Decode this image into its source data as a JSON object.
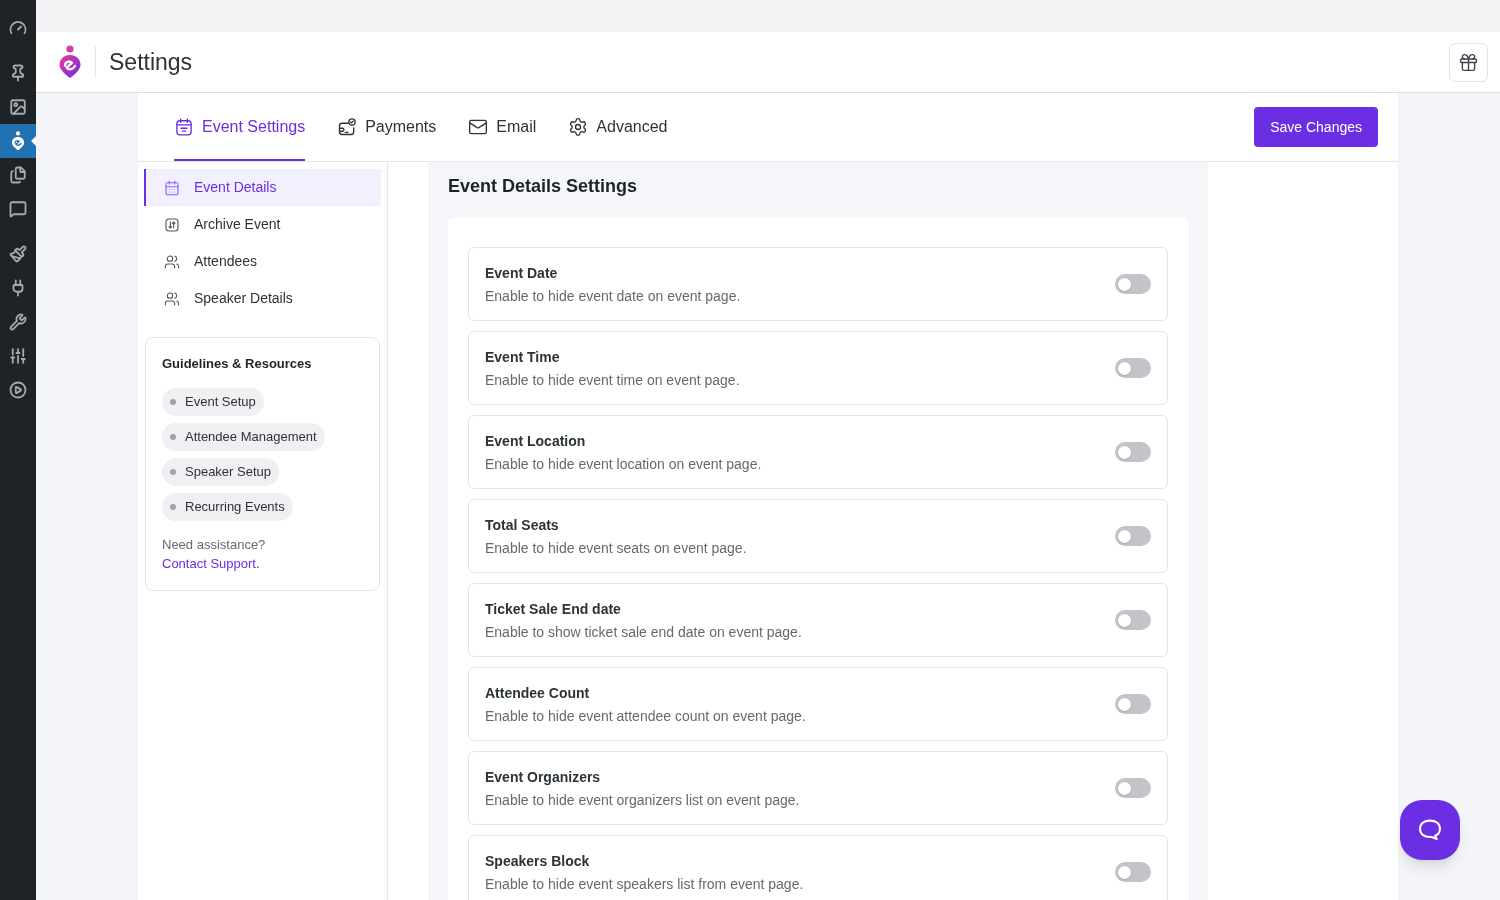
{
  "admin_menu": {
    "items": [
      {
        "selected": false
      },
      {
        "selected": false
      },
      {
        "selected": false
      },
      {
        "selected": true
      },
      {
        "selected": false
      },
      {
        "selected": false
      },
      {
        "selected": false
      },
      {
        "selected": false
      },
      {
        "selected": false
      },
      {
        "selected": false
      },
      {
        "selected": false
      }
    ]
  },
  "header": {
    "title": "Settings"
  },
  "tabs": [
    {
      "label": "Event Settings",
      "selected": true
    },
    {
      "label": "Payments",
      "selected": false
    },
    {
      "label": "Email",
      "selected": false
    },
    {
      "label": "Advanced",
      "selected": false
    }
  ],
  "save_button": "Save Changes",
  "subnav": [
    {
      "label": "Event Details",
      "selected": true
    },
    {
      "label": "Archive Event",
      "selected": false
    },
    {
      "label": "Attendees",
      "selected": false
    },
    {
      "label": "Speaker Details",
      "selected": false
    }
  ],
  "guidelines": {
    "title": "Guidelines & Resources",
    "links": [
      "Event Setup",
      "Attendee Management",
      "Speaker Setup",
      "Recurring Events"
    ],
    "help": {
      "text": "Need assistance?",
      "link": "Contact Support."
    }
  },
  "section": {
    "title": "Event Details Settings",
    "settings": [
      {
        "title": "Event Date",
        "description": "Enable to hide event date on event page.",
        "on": false
      },
      {
        "title": "Event Time",
        "description": "Enable to hide event time on event page.",
        "on": false
      },
      {
        "title": "Event Location",
        "description": "Enable to hide event location on event page.",
        "on": false
      },
      {
        "title": "Total Seats",
        "description": "Enable to hide event seats on event page.",
        "on": false
      },
      {
        "title": "Ticket Sale End date",
        "description": "Enable to show ticket sale end date on event page.",
        "on": false
      },
      {
        "title": "Attendee Count",
        "description": "Enable to hide event attendee count on event page.",
        "on": false
      },
      {
        "title": "Event Organizers",
        "description": "Enable to hide event organizers list on event page.",
        "on": false
      },
      {
        "title": "Speakers Block",
        "description": "Enable to hide event speakers list from event page.",
        "on": false
      }
    ]
  }
}
